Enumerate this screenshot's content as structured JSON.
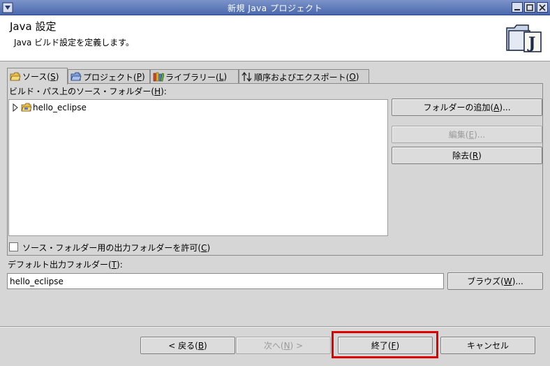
{
  "window": {
    "title": "新規 Java プロジェクト",
    "controls": [
      "minimize",
      "maximize",
      "close"
    ]
  },
  "header": {
    "title": "Java 設定",
    "description": "Java ビルド設定を定義します。",
    "icon": "java-project-folder-icon"
  },
  "tabs": [
    {
      "label": "ソース(",
      "mnemonic": "S",
      "suffix": ")",
      "icon": "source-folder-icon",
      "active": true
    },
    {
      "label": "プロジェクト(",
      "mnemonic": "P",
      "suffix": ")",
      "icon": "project-icon",
      "active": false
    },
    {
      "label": "ライブラリー(",
      "mnemonic": "L",
      "suffix": ")",
      "icon": "library-icon",
      "active": false
    },
    {
      "label": "順序およびエクスポート(",
      "mnemonic": "O",
      "suffix": ")",
      "icon": "order-arrows-icon",
      "active": false
    }
  ],
  "source_panel": {
    "label": "ビルド・パス上のソース・フォルダー(",
    "label_mnemonic": "H",
    "label_suffix": "):",
    "tree": [
      {
        "name": "hello_eclipse",
        "icon": "source-folder-icon",
        "expanded": false
      }
    ],
    "buttons": {
      "add_folder": {
        "label": "フォルダーの追加(",
        "mnemonic": "A",
        "suffix": ")..."
      },
      "edit": {
        "label": "編集(",
        "mnemonic": "E",
        "suffix": ")..."
      },
      "remove": {
        "label": "除去(",
        "mnemonic": "R",
        "suffix": ")"
      }
    },
    "allow_output_folders": {
      "label": "ソース・フォルダー用の出力フォルダーを許可(",
      "mnemonic": "C",
      "suffix": ")",
      "checked": false
    }
  },
  "default_output": {
    "label": "デフォルト出力フォルダー(",
    "mnemonic": "T",
    "suffix": "):",
    "value": "hello_eclipse",
    "browse": {
      "label": "ブラウズ(",
      "mnemonic": "W",
      "suffix": ")..."
    }
  },
  "footer": {
    "back": {
      "label": "< 戻る(",
      "mnemonic": "B",
      "suffix": ")"
    },
    "next": {
      "label": "次へ(",
      "mnemonic": "N",
      "suffix": ") >"
    },
    "finish": {
      "label": "終了(",
      "mnemonic": "F",
      "suffix": ")"
    },
    "cancel": {
      "label": "キャンセル"
    }
  },
  "colors": {
    "titlebar": "#5a77b8",
    "highlight": "#e00000",
    "folder": "#e8c04a"
  }
}
